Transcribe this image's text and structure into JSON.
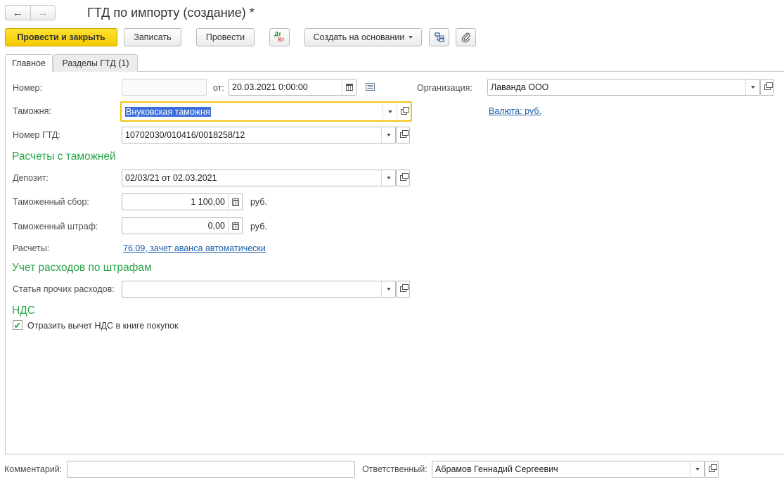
{
  "window": {
    "title": "ГТД по импорту (создание) *",
    "back_glyph": "←",
    "forward_glyph": "→"
  },
  "toolbar": {
    "post_and_close": "Провести и закрыть",
    "save": "Записать",
    "post": "Провести",
    "dtkt_top": "Дт",
    "dtkt_bottom": "Кт",
    "create_based_on": "Создать на основании"
  },
  "tabs": [
    {
      "label": "Главное",
      "active": true
    },
    {
      "label": "Разделы ГТД (1)",
      "active": false
    }
  ],
  "header_fields": {
    "number_label": "Номер:",
    "number_value": "",
    "date_label": "от:",
    "date_value": "20.03.2021  0:00:00",
    "organization_label": "Организация:",
    "organization_value": "Лаванда ООО",
    "customs_label": "Таможня:",
    "customs_value": "Внуковская таможня",
    "currency_link": "Валюта: руб.",
    "gtd_number_label": "Номер ГТД:",
    "gtd_number_value": "10702030/010416/0018258/12"
  },
  "customs_settlements": {
    "section_title": "Расчеты с таможней",
    "deposit_label": "Депозит:",
    "deposit_value": "02/03/21 от 02.03.2021",
    "customs_fee_label": "Таможенный сбор:",
    "customs_fee_value": "1 100,00",
    "customs_fee_currency": "руб.",
    "customs_fine_label": "Таможенный штраф:",
    "customs_fine_value": "0,00",
    "customs_fine_currency": "руб.",
    "settlements_label": "Расчеты:",
    "settlements_link": "76.09, зачет аванса автоматически"
  },
  "fines_accounting": {
    "section_title": "Учет расходов по штрафам",
    "other_expenses_label": "Статья прочих расходов:",
    "other_expenses_value": ""
  },
  "vat": {
    "section_title": "НДС",
    "deduction_checkbox_label": "Отразить вычет НДС в книге покупок",
    "deduction_checked": true,
    "check_glyph": "✔"
  },
  "footer": {
    "comment_label": "Комментарий:",
    "comment_value": "",
    "responsible_label": "Ответственный:",
    "responsible_value": "Абрамов Геннадий Сергеевич"
  },
  "colors": {
    "primary_button": "#f4c900",
    "section_title": "#2aa44a",
    "link": "#1a5ea8",
    "focus_border": "#f2c30f",
    "selection": "#3d6fd8"
  },
  "icons": [
    "back-arrow-icon",
    "forward-arrow-icon",
    "dt-kt-icon",
    "structure-icon",
    "paperclip-icon",
    "calendar-icon",
    "calculator-icon",
    "list-icon",
    "dropdown-arrow-icon",
    "open-icon",
    "checkmark-icon"
  ]
}
